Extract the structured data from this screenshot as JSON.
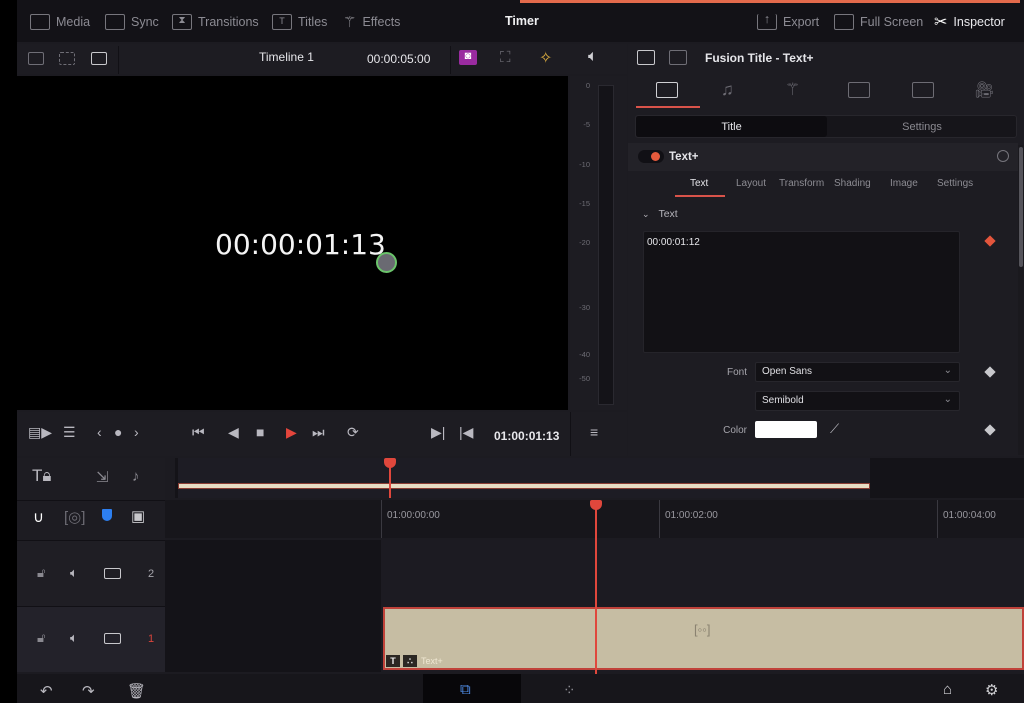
{
  "topbar": {
    "items": [
      {
        "label": "Media",
        "icon": "media-icon"
      },
      {
        "label": "Sync",
        "icon": "sync-icon"
      },
      {
        "label": "Transitions",
        "icon": "transitions-icon"
      },
      {
        "label": "Titles",
        "icon": "titles-icon"
      },
      {
        "label": "Effects",
        "icon": "effects-icon"
      }
    ],
    "project_title": "Timer",
    "right_items": [
      {
        "label": "Export",
        "icon": "export-icon"
      },
      {
        "label": "Full Screen",
        "icon": "fullscreen-icon"
      },
      {
        "label": "Inspector",
        "icon": "inspector-icon"
      }
    ]
  },
  "viewer": {
    "timeline_name": "Timeline 1",
    "duration": "00:00:05:00",
    "overlay_text": "00:00:01:13"
  },
  "meter": {
    "labels": [
      "0",
      "-5",
      "-10",
      "-15",
      "-20",
      "-30",
      "-40",
      "-50"
    ]
  },
  "transport": {
    "timecode": "01:00:01:13"
  },
  "inspector": {
    "title": "Fusion Title - Text+",
    "segments": {
      "title": "Title",
      "settings": "Settings"
    },
    "node_name": "Text+",
    "subtabs": [
      "Text",
      "Layout",
      "Transform",
      "Shading",
      "Image",
      "Settings"
    ],
    "active_subtab": "Text",
    "section": "Text",
    "text_value": "00:00:01:12",
    "font_label": "Font",
    "font_value": "Open Sans",
    "style_value": "Semibold",
    "color_label": "Color",
    "color_value": "#ffffff",
    "accent_color": "#d9534a"
  },
  "timeline": {
    "ruler_labels": [
      "01:00:00:00",
      "01:00:02:00",
      "01:00:04:00"
    ],
    "tracks": [
      {
        "number": "2"
      },
      {
        "number": "1"
      }
    ],
    "clip_label": "Text+"
  }
}
